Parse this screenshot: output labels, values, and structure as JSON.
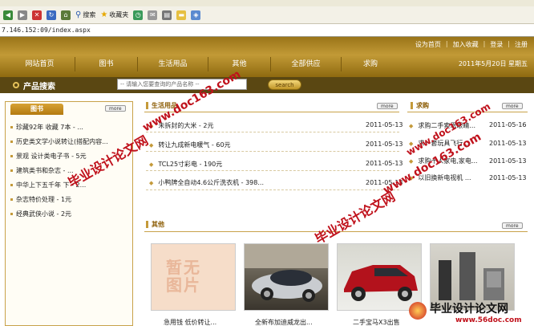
{
  "browser": {
    "toolbar": {
      "search_label": "搜索",
      "favorites_label": "收藏夹"
    },
    "address": "7.146.152:09/index.aspx"
  },
  "header": {
    "top_links": [
      "设为首页",
      "加入收藏",
      "登录",
      "注册"
    ],
    "nav": [
      "网站首页",
      "图书",
      "生活用品",
      "其他",
      "全部供应",
      "求购"
    ],
    "date": "2011年5月20日 星期五"
  },
  "search": {
    "title": "产品搜索",
    "placeholder": "-- 请输入您要查询的产品名称 --",
    "button": "search"
  },
  "books": {
    "tab": "图书",
    "more": "more",
    "items": [
      "珍藏92年 收藏 7本 - ...",
      "历史类文学小说转让(搭配内容...",
      "景观 设计类电子书 - 5元",
      "建筑类书和杂志 - ...",
      "中华上下五千年 下 - 2...",
      "杂志特价处理 - 1元",
      "经典武侠小说 - 2元"
    ]
  },
  "daily": {
    "title": "生活用品",
    "more": "more",
    "items": [
      {
        "text": "未拆封的大米 - 2元",
        "date": "2011-05-13"
      },
      {
        "text": "转让九成新电暖气 - 60元",
        "date": "2011-05-13"
      },
      {
        "text": "TCL25寸彩电 - 190元",
        "date": "2011-05-13"
      },
      {
        "text": "小鸭牌全自动4.6公斤洗衣机 - 398...",
        "date": "2011-05-13"
      }
    ]
  },
  "wanted": {
    "title": "求购",
    "more": "more",
    "items": [
      {
        "text": "求购二手索恩眼睛...",
        "date": "2011-05-16"
      },
      {
        "text": "求一套玩具飞行...",
        "date": "2011-05-13"
      },
      {
        "text": "求购十人家电,家电...",
        "date": "2011-05-13"
      },
      {
        "text": "以旧换新电视机 ...",
        "date": "2011-05-13"
      }
    ]
  },
  "others": {
    "title": "其他",
    "more": "more",
    "placeholder_text": [
      "暂无",
      "图片"
    ],
    "captions": [
      "急用钱 低价转让...",
      "全新布加迪威龙出...",
      "二手宝马X3出售",
      ""
    ]
  },
  "watermarks": {
    "text1": "毕业设计论文网",
    "text2": "www.doc163.com",
    "brand": "毕业设计论文网",
    "brand_url": "www.56doc.com"
  }
}
